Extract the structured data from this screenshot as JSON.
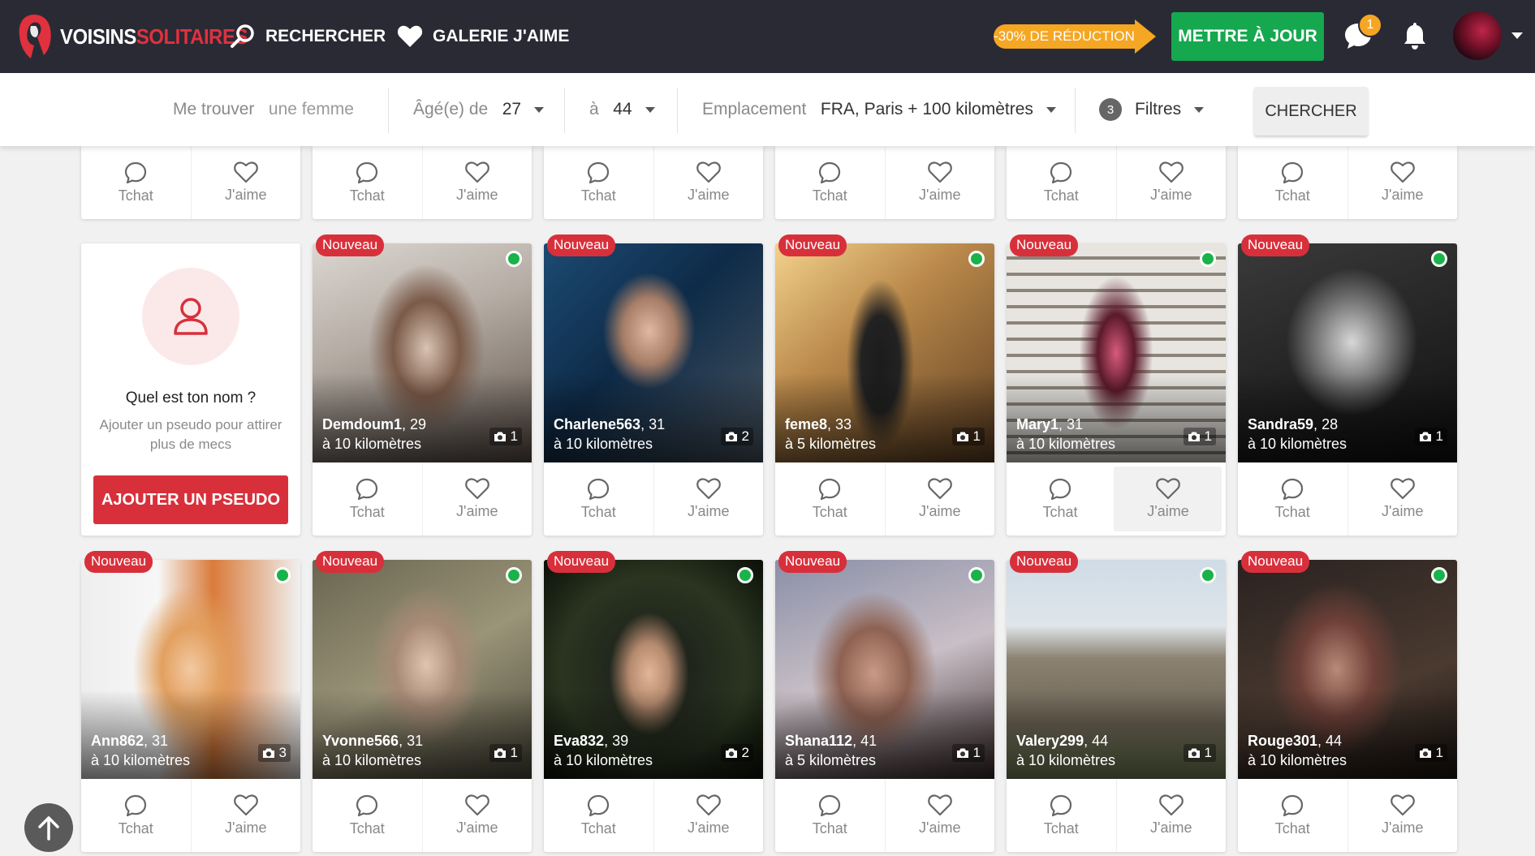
{
  "brand": {
    "part1": "VOISINS",
    "part2": "SOLITAIRES"
  },
  "nav": {
    "search": "RECHERCHER",
    "likes": "GALERIE J'AIME"
  },
  "promo": {
    "label": "-30% DE RÉDUCTION"
  },
  "upgrade": {
    "label": "METTRE À JOUR"
  },
  "notifications": {
    "messages_count": "1"
  },
  "filters": {
    "find_label": "Me trouver",
    "find_value": "une femme",
    "age_label": "Âgé(e) de",
    "age_min": "27",
    "age_to": "à",
    "age_max": "44",
    "location_label": "Emplacement",
    "location_value": "FRA, Paris + 100 kilomètres",
    "filter_count": "3",
    "filter_label": "Filtres",
    "search_button": "CHERCHER"
  },
  "actions": {
    "chat": "Tchat",
    "like": "J'aime"
  },
  "badges": {
    "new": "Nouveau"
  },
  "promo_card": {
    "title": "Quel est ton nom ?",
    "subtitle": "Ajouter un pseudo pour attirer plus de mecs",
    "button": "AJOUTER UN PSEUDO"
  },
  "profiles_row1": [
    {
      "name": "Demdoum1",
      "age": "29",
      "distance": "à 10 kilomètres",
      "photos": "1",
      "online": true
    },
    {
      "name": "Charlene563",
      "age": "31",
      "distance": "à 10 kilomètres",
      "photos": "2",
      "online": false
    },
    {
      "name": "feme8",
      "age": "33",
      "distance": "à 5 kilomètres",
      "photos": "1",
      "online": true
    },
    {
      "name": "Mary1",
      "age": "31",
      "distance": "à 10 kilomètres",
      "photos": "1",
      "online": true
    },
    {
      "name": "Sandra59",
      "age": "28",
      "distance": "à 10 kilomètres",
      "photos": "1",
      "online": true
    }
  ],
  "profiles_row2": [
    {
      "name": "Ann862",
      "age": "31",
      "distance": "à 10 kilomètres",
      "photos": "3",
      "online": true
    },
    {
      "name": "Yvonne566",
      "age": "31",
      "distance": "à 10 kilomètres",
      "photos": "1",
      "online": true
    },
    {
      "name": "Eva832",
      "age": "39",
      "distance": "à 10 kilomètres",
      "photos": "2",
      "online": true
    },
    {
      "name": "Shana112",
      "age": "41",
      "distance": "à 5 kilomètres",
      "photos": "1",
      "online": true
    },
    {
      "name": "Valery299",
      "age": "44",
      "distance": "à 10 kilomètres",
      "photos": "1",
      "online": true
    },
    {
      "name": "Rouge301",
      "age": "44",
      "distance": "à 10 kilomètres",
      "photos": "1",
      "online": true
    }
  ]
}
